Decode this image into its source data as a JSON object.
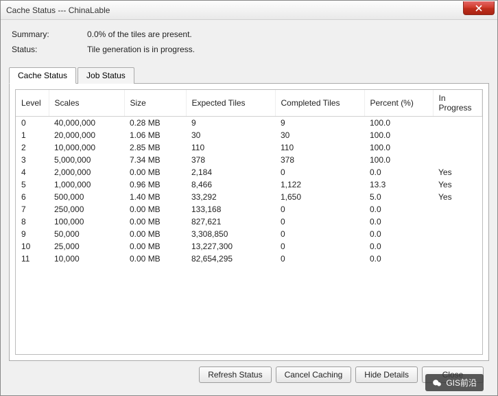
{
  "window": {
    "title": "Cache Status --- ChinaLable"
  },
  "summary": {
    "label_summary": "Summary:",
    "summary_text": "0.0% of the tiles are present.",
    "label_status": "Status:",
    "status_text": "Tile generation is in progress."
  },
  "tabs": {
    "cache_status": "Cache Status",
    "job_status": "Job Status"
  },
  "table": {
    "headers": {
      "level": "Level",
      "scales": "Scales",
      "size": "Size",
      "expected": "Expected Tiles",
      "completed": "Completed Tiles",
      "percent": "Percent (%)",
      "in_progress": "In Progress"
    },
    "rows": [
      {
        "level": "0",
        "scales": "40,000,000",
        "size": "0.28 MB",
        "expected": "9",
        "completed": "9",
        "percent": "100.0",
        "in_progress": ""
      },
      {
        "level": "1",
        "scales": "20,000,000",
        "size": "1.06 MB",
        "expected": "30",
        "completed": "30",
        "percent": "100.0",
        "in_progress": ""
      },
      {
        "level": "2",
        "scales": "10,000,000",
        "size": "2.85 MB",
        "expected": "110",
        "completed": "110",
        "percent": "100.0",
        "in_progress": ""
      },
      {
        "level": "3",
        "scales": "5,000,000",
        "size": "7.34 MB",
        "expected": "378",
        "completed": "378",
        "percent": "100.0",
        "in_progress": ""
      },
      {
        "level": "4",
        "scales": "2,000,000",
        "size": "0.00 MB",
        "expected": "2,184",
        "completed": "0",
        "percent": "0.0",
        "in_progress": "Yes"
      },
      {
        "level": "5",
        "scales": "1,000,000",
        "size": "0.96 MB",
        "expected": "8,466",
        "completed": "1,122",
        "percent": "13.3",
        "in_progress": "Yes"
      },
      {
        "level": "6",
        "scales": "500,000",
        "size": "1.40 MB",
        "expected": "33,292",
        "completed": "1,650",
        "percent": "5.0",
        "in_progress": "Yes"
      },
      {
        "level": "7",
        "scales": "250,000",
        "size": "0.00 MB",
        "expected": "133,168",
        "completed": "0",
        "percent": "0.0",
        "in_progress": ""
      },
      {
        "level": "8",
        "scales": "100,000",
        "size": "0.00 MB",
        "expected": "827,621",
        "completed": "0",
        "percent": "0.0",
        "in_progress": ""
      },
      {
        "level": "9",
        "scales": "50,000",
        "size": "0.00 MB",
        "expected": "3,308,850",
        "completed": "0",
        "percent": "0.0",
        "in_progress": ""
      },
      {
        "level": "10",
        "scales": "25,000",
        "size": "0.00 MB",
        "expected": "13,227,300",
        "completed": "0",
        "percent": "0.0",
        "in_progress": ""
      },
      {
        "level": "11",
        "scales": "10,000",
        "size": "0.00 MB",
        "expected": "82,654,295",
        "completed": "0",
        "percent": "0.0",
        "in_progress": ""
      }
    ]
  },
  "buttons": {
    "refresh": "Refresh Status",
    "cancel": "Cancel Caching",
    "hide_details": "Hide Details",
    "close": "Close"
  },
  "watermark": {
    "text": "GIS前沿"
  }
}
